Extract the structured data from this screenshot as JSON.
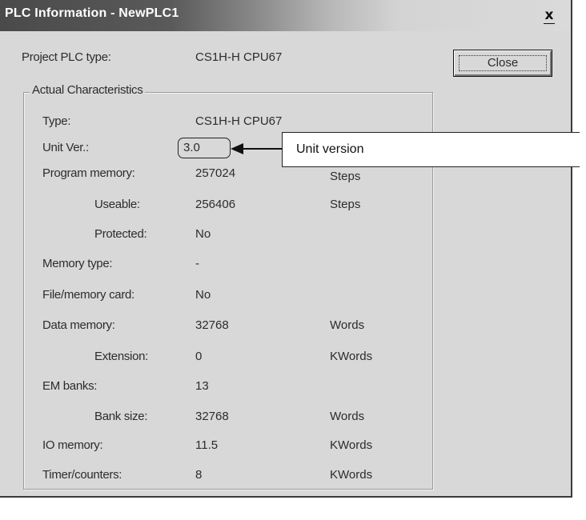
{
  "window": {
    "title": "PLC Information - NewPLC1",
    "close_glyph": "x"
  },
  "project": {
    "label": "Project PLC type:",
    "value": "CS1H-H CPU67"
  },
  "buttons": {
    "close_label": "Close"
  },
  "group": {
    "legend": "Actual Characteristics",
    "rows": [
      {
        "label": "Type:",
        "value": "CS1H-H CPU67",
        "unit": ""
      },
      {
        "label": "Unit Ver.:",
        "value": "3.0",
        "unit": ""
      },
      {
        "label": "Program memory:",
        "value": "257024",
        "unit": "Steps"
      },
      {
        "label": "Useable:",
        "value": "256406",
        "unit": "Steps"
      },
      {
        "label": "Protected:",
        "value": "No",
        "unit": ""
      },
      {
        "label": "Memory type:",
        "value": "-",
        "unit": ""
      },
      {
        "label": "File/memory card:",
        "value": "No",
        "unit": ""
      },
      {
        "label": "Data memory:",
        "value": "32768",
        "unit": "Words"
      },
      {
        "label": "Extension:",
        "value": "0",
        "unit": "KWords"
      },
      {
        "label": "EM banks:",
        "value": "13",
        "unit": ""
      },
      {
        "label": "Bank size:",
        "value": "32768",
        "unit": "Words"
      },
      {
        "label": "IO memory:",
        "value": "11.5",
        "unit": "KWords"
      },
      {
        "label": "Timer/counters:",
        "value": "8",
        "unit": "KWords"
      }
    ]
  },
  "annotation": {
    "text": "Unit version"
  }
}
